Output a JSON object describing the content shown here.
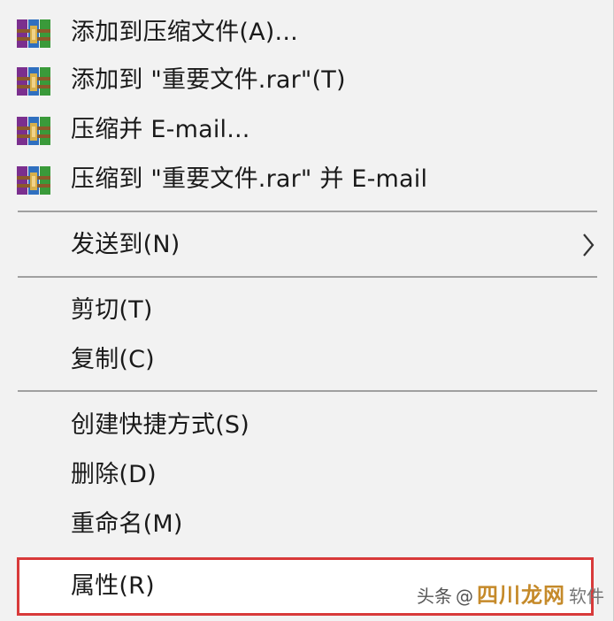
{
  "menu": {
    "items": [
      {
        "label": "添加到压缩文件(A)...",
        "icon": "winrar-archive-icon"
      },
      {
        "label": "添加到 \"重要文件.rar\"(T)",
        "icon": "winrar-archive-icon"
      },
      {
        "label": "压缩并 E-mail...",
        "icon": "winrar-archive-icon"
      },
      {
        "label": "压缩到 \"重要文件.rar\" 并 E-mail",
        "icon": "winrar-archive-icon"
      },
      {
        "label": "发送到(N)",
        "icon": "chevron-right-icon"
      },
      {
        "label": "剪切(T)"
      },
      {
        "label": "复制(C)"
      },
      {
        "label": "创建快捷方式(S)"
      },
      {
        "label": "删除(D)"
      },
      {
        "label": "重命名(M)"
      },
      {
        "label": "属性(R)"
      }
    ]
  },
  "watermark": {
    "prefix": "头条",
    "at": "@",
    "site": "四川龙网",
    "suffix": "软件"
  },
  "colors": {
    "menu_background": "#f2f2f2",
    "separator": "#a0a0a0",
    "highlight_border": "#d83a3a",
    "text": "#1a1a1a"
  }
}
